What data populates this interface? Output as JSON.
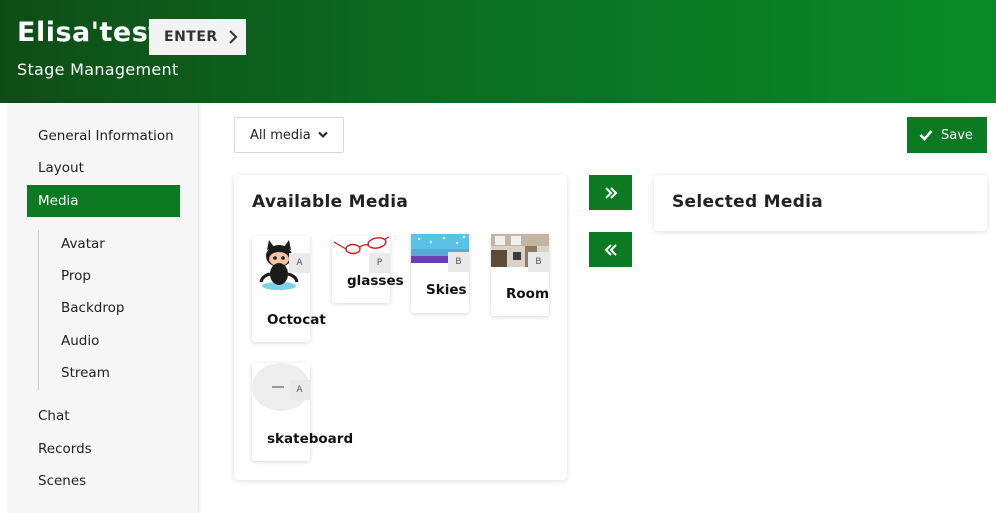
{
  "header": {
    "stage_title": "Elisa'test",
    "enter_label": "ENTER",
    "subtitle": "Stage Management"
  },
  "sidebar": {
    "items": [
      {
        "label": "General Information"
      },
      {
        "label": "Layout"
      },
      {
        "label": "Media",
        "active": true
      },
      {
        "label": "Chat"
      },
      {
        "label": "Records"
      },
      {
        "label": "Scenes"
      }
    ],
    "media_subitems": [
      {
        "label": "Avatar"
      },
      {
        "label": "Prop"
      },
      {
        "label": "Backdrop"
      },
      {
        "label": "Audio"
      },
      {
        "label": "Stream"
      }
    ]
  },
  "toolbar": {
    "filter_value": "All media",
    "save_label": "Save"
  },
  "available": {
    "title": "Available Media",
    "items": [
      {
        "name": "Octocat",
        "type": "A",
        "thumb": "octocat-icon"
      },
      {
        "name": "glasses",
        "type": "P",
        "thumb": "glasses-icon"
      },
      {
        "name": "Skies",
        "type": "B",
        "thumb": "skies-image"
      },
      {
        "name": "Room",
        "type": "B",
        "thumb": "room-image"
      },
      {
        "name": "skateboard",
        "type": "A",
        "thumb": "skateboard-icon"
      }
    ]
  },
  "selected": {
    "title": "Selected Media"
  },
  "colors": {
    "accent": "#0b7a22",
    "header_start": "#0f4d16",
    "header_end": "#098a27"
  }
}
